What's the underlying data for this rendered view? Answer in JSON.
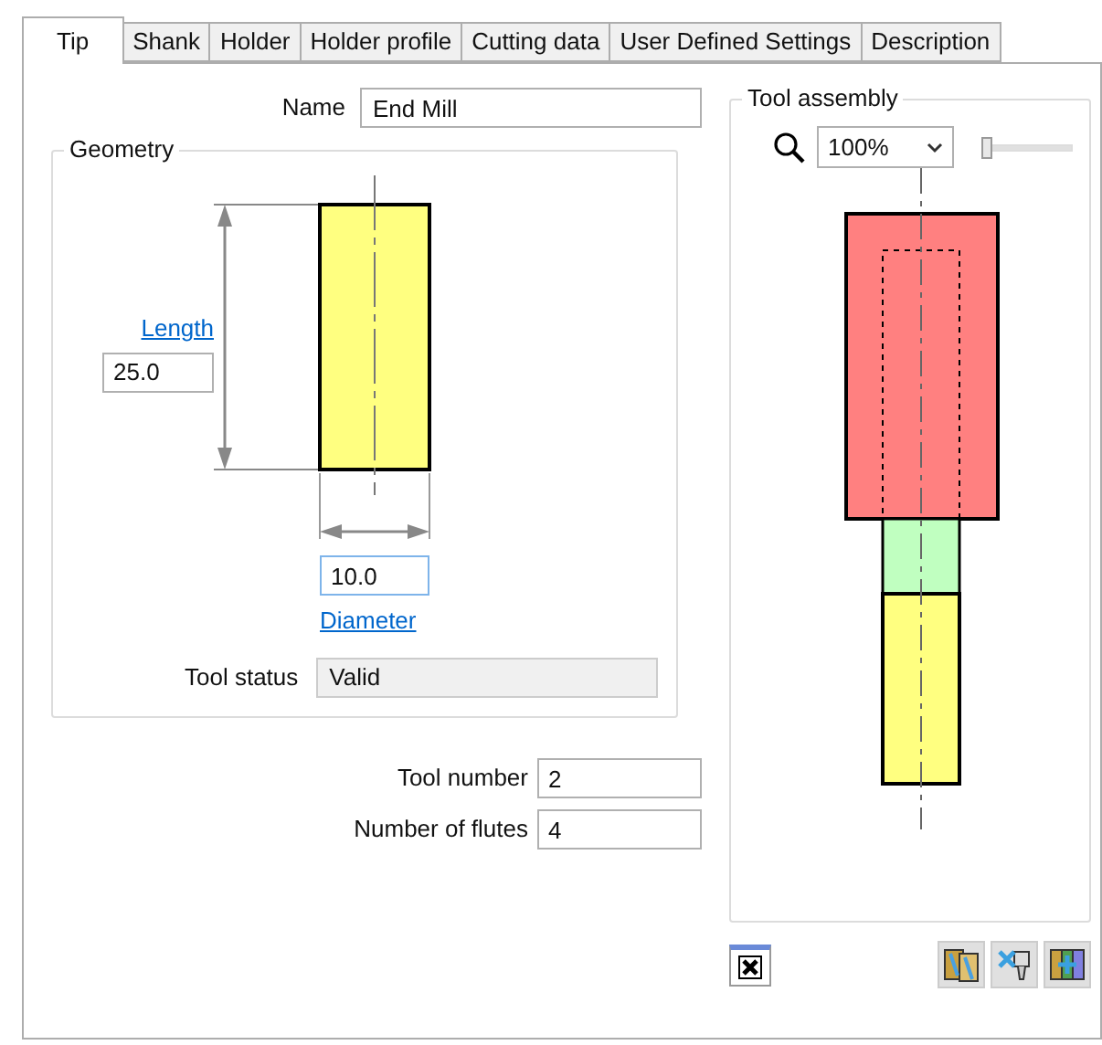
{
  "tabs": [
    {
      "label": "Tip",
      "selected": true
    },
    {
      "label": "Shank",
      "selected": false
    },
    {
      "label": "Holder",
      "selected": false
    },
    {
      "label": "Holder profile",
      "selected": false
    },
    {
      "label": "Cutting data",
      "selected": false
    },
    {
      "label": "User Defined Settings",
      "selected": false
    },
    {
      "label": "Description",
      "selected": false
    }
  ],
  "name": {
    "label": "Name",
    "value": "End Mill"
  },
  "geometry": {
    "title": "Geometry",
    "length": {
      "link": "Length",
      "value": "25.0"
    },
    "diameter": {
      "link": "Diameter",
      "value": "10.0",
      "focused": true
    },
    "tool_status": {
      "label": "Tool status",
      "value": "Valid"
    }
  },
  "fields": [
    {
      "label": "Tool number",
      "value": "2"
    },
    {
      "label": "Number of flutes",
      "value": "4"
    }
  ],
  "tool_assembly": {
    "title": "Tool assembly",
    "zoom": "100%",
    "zoom_slider": {
      "level": 0
    }
  }
}
